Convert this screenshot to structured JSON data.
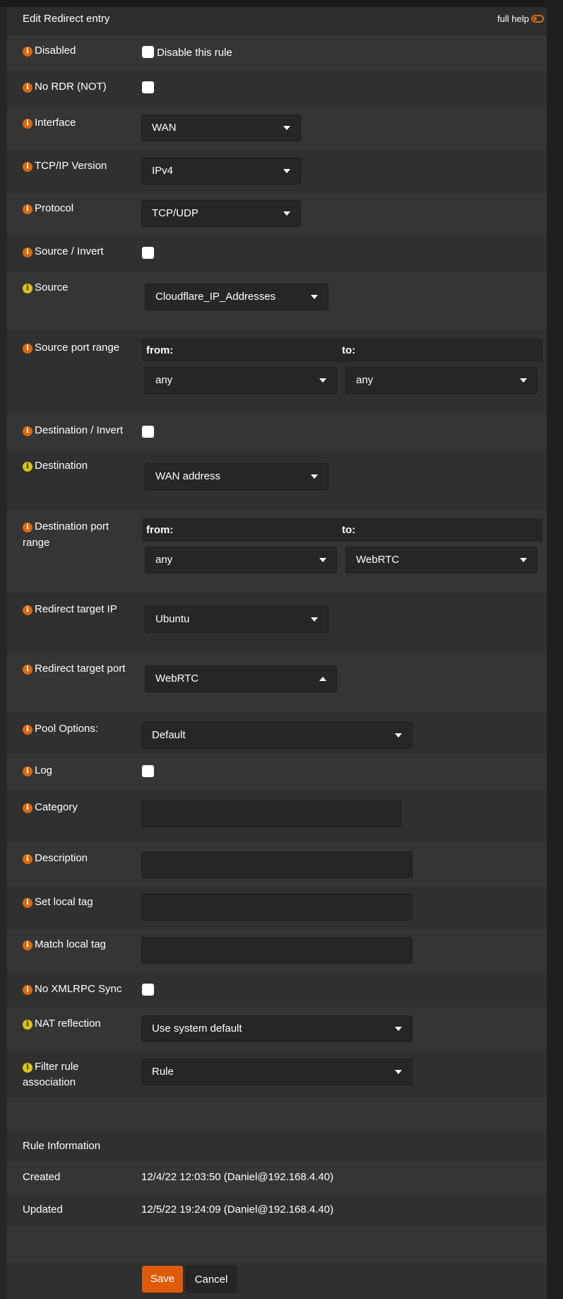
{
  "header": {
    "title": "Edit Redirect entry",
    "full_help": "full help"
  },
  "fields": {
    "disabled": {
      "label": "Disabled",
      "checkbox_label": "Disable this rule"
    },
    "no_rdr": {
      "label": "No RDR (NOT)"
    },
    "interface": {
      "label": "Interface",
      "value": "WAN"
    },
    "tcpip_version": {
      "label": "TCP/IP Version",
      "value": "IPv4"
    },
    "protocol": {
      "label": "Protocol",
      "value": "TCP/UDP"
    },
    "source_invert": {
      "label": "Source / Invert"
    },
    "source": {
      "label": "Source",
      "value": "Cloudflare_IP_Addresses"
    },
    "source_port_range": {
      "label": "Source port range",
      "from_label": "from:",
      "to_label": "to:",
      "from_value": "any",
      "to_value": "any"
    },
    "destination_invert": {
      "label": "Destination / Invert"
    },
    "destination": {
      "label": "Destination",
      "value": "WAN address"
    },
    "destination_port_range": {
      "label_line1": "Destination port",
      "label_line2": "range",
      "from_label": "from:",
      "to_label": "to:",
      "from_value": "any",
      "to_value": "WebRTC"
    },
    "redirect_target_ip": {
      "label": "Redirect target IP",
      "value": "Ubuntu"
    },
    "redirect_target_port": {
      "label": "Redirect target port",
      "value": "WebRTC"
    },
    "pool_options": {
      "label": "Pool Options:",
      "value": "Default"
    },
    "log": {
      "label": "Log"
    },
    "category": {
      "label": "Category",
      "value": ""
    },
    "description": {
      "label": "Description",
      "value": ""
    },
    "set_local_tag": {
      "label": "Set local tag",
      "value": ""
    },
    "match_local_tag": {
      "label": "Match local tag",
      "value": ""
    },
    "no_xmlrpc_sync": {
      "label": "No XMLRPC Sync"
    },
    "nat_reflection": {
      "label": "NAT reflection",
      "value": "Use system default"
    },
    "filter_rule_association": {
      "label_line1": "Filter rule",
      "label_line2": "association",
      "value": "Rule"
    }
  },
  "rule_info": {
    "title": "Rule Information",
    "created_label": "Created",
    "created_value": "12/4/22 12:03:50 (Daniel@192.168.4.40)",
    "updated_label": "Updated",
    "updated_value": "12/5/22 19:24:09 (Daniel@192.168.4.40)"
  },
  "buttons": {
    "save": "Save",
    "cancel": "Cancel"
  },
  "colors": {
    "accent": "#e05a0b",
    "info_icon": "#d9690f",
    "info_icon_alt": "#d8c21a"
  }
}
